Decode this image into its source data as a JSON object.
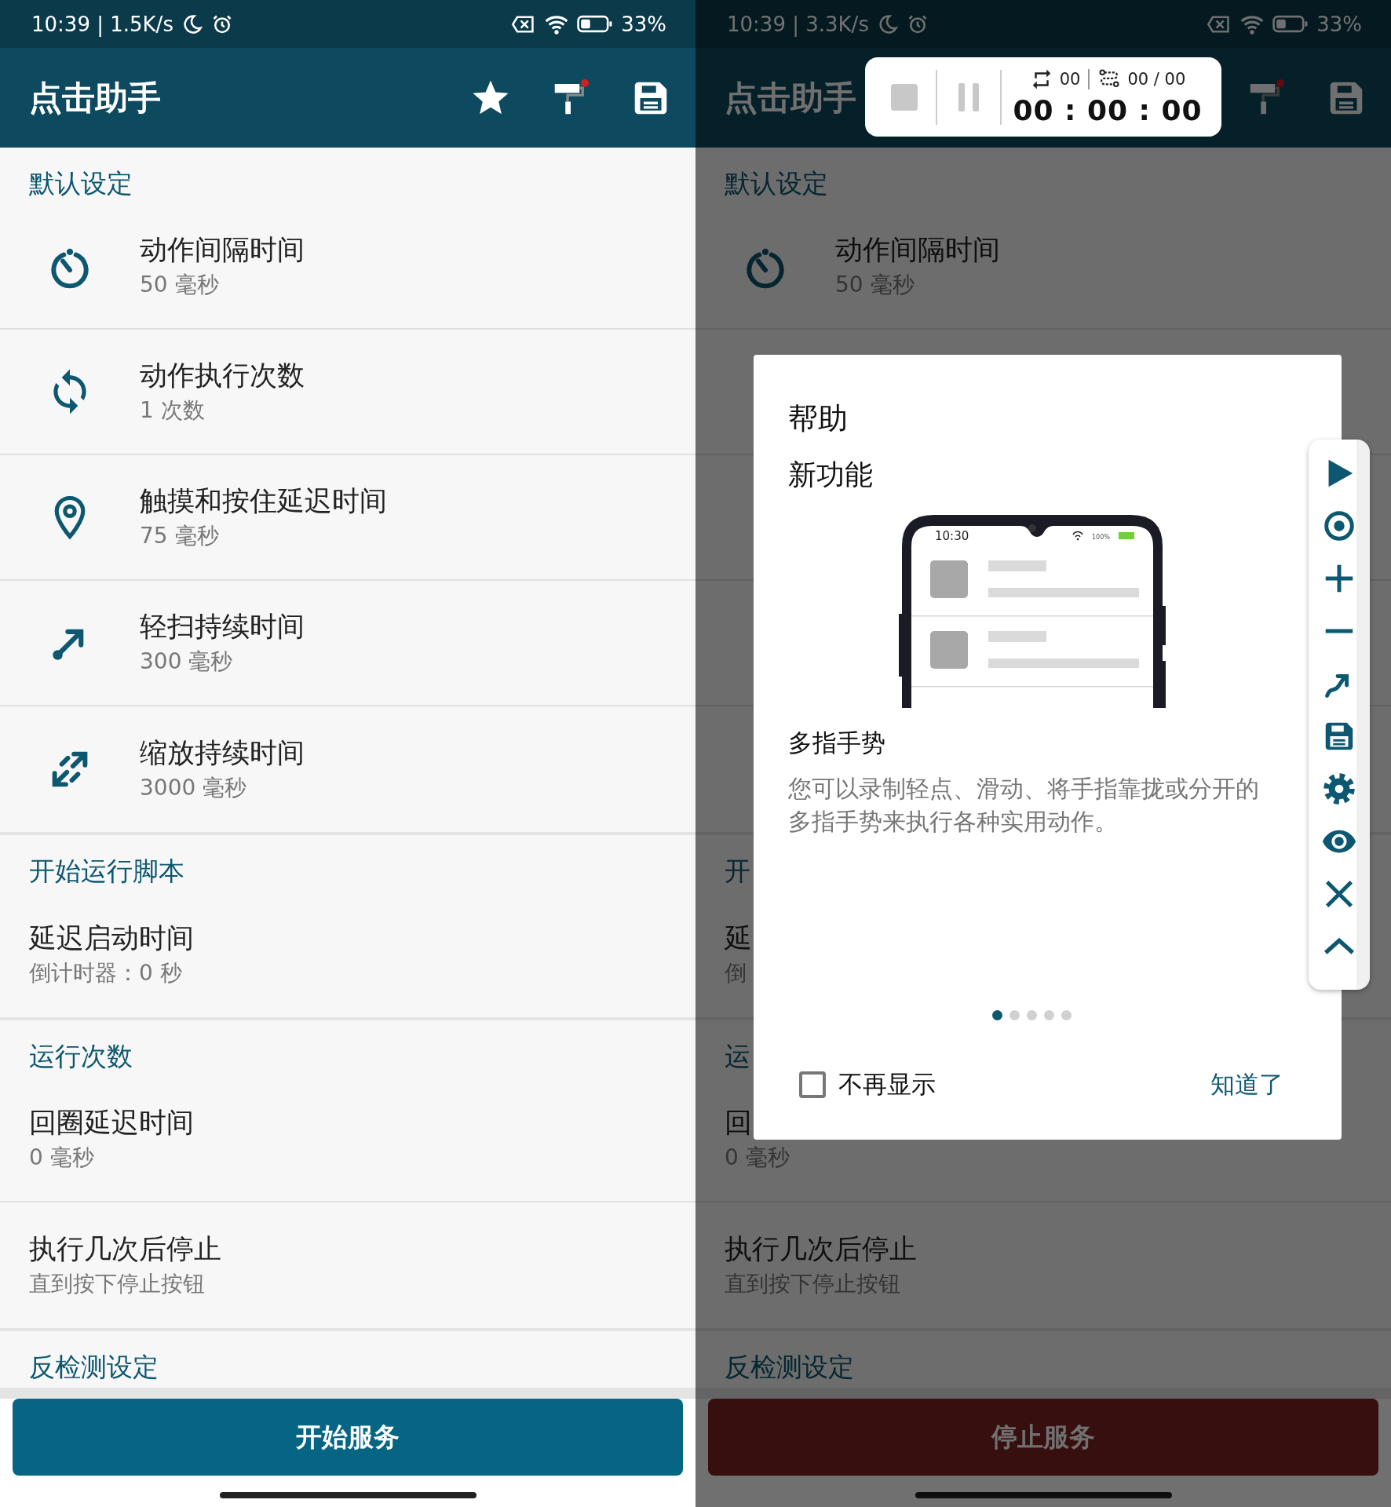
{
  "screens": [
    {
      "status": {
        "time": "10:39 | 1.5K/s",
        "battery": "33%"
      },
      "app_bar": {
        "title": "点击助手",
        "actions": [
          {
            "kind": "star"
          },
          {
            "kind": "roller"
          },
          {
            "kind": "save"
          }
        ]
      },
      "sections": [
        {
          "header": "默认设定",
          "items": [
            {
              "kind": "timer",
              "title": "动作间隔时间",
              "subtitle": "50 毫秒"
            },
            {
              "kind": "sync",
              "title": "动作执行次数",
              "subtitle": "1 次数"
            },
            {
              "kind": "pin",
              "title": "触摸和按住延迟时间",
              "subtitle": "75 毫秒"
            },
            {
              "kind": "swipe",
              "title": "轻扫持续时间",
              "subtitle": "300 毫秒"
            },
            {
              "kind": "pinch",
              "title": "缩放持续时间",
              "subtitle": "3000 毫秒"
            }
          ]
        },
        {
          "header": "开始运行脚本",
          "items": [
            {
              "kind": "plain",
              "title": "延迟启动时间",
              "subtitle": "倒计时器：0 秒"
            }
          ]
        },
        {
          "header": "运行次数",
          "items": [
            {
              "kind": "plain",
              "title": "回圈延迟时间",
              "subtitle": "0 毫秒"
            },
            {
              "kind": "plain",
              "title": "执行几次后停止",
              "subtitle": "直到按下停止按钮"
            }
          ]
        },
        {
          "header": "反检测设定"
        }
      ],
      "button": {
        "kind": "start",
        "label": "开始服务"
      }
    },
    {
      "dimmed": true,
      "status": {
        "time": "10:39 | 3.3K/s",
        "battery": "33%"
      },
      "app_bar": {
        "title": "点击助手",
        "actions": [
          {
            "kind": "roller"
          },
          {
            "kind": "save"
          }
        ]
      },
      "sections": [
        {
          "header": "默认设定",
          "items": [
            {
              "kind": "timer",
              "title": "动作间隔时间",
              "subtitle": "50 毫秒"
            },
            {
              "kind": "covered"
            },
            {
              "kind": "covered"
            },
            {
              "kind": "covered"
            },
            {
              "kind": "covered"
            }
          ]
        },
        {
          "header": "开",
          "items": [
            {
              "kind": "plain",
              "title": "延",
              "subtitle": "倒"
            }
          ]
        },
        {
          "header": "运",
          "items": [
            {
              "kind": "plain",
              "title": "回",
              "subtitle": "0 毫秒"
            },
            {
              "kind": "plain",
              "title": "执行几次后停止",
              "subtitle": "直到按下停止按钮"
            }
          ]
        },
        {
          "header": "反检测设定"
        }
      ],
      "button": {
        "kind": "stop",
        "label": "停止服务"
      },
      "recording_bar": {
        "stop": {
          "disabled": true
        },
        "pause": {
          "disabled": true
        },
        "loop_count": "00",
        "route_count": "00 / 00",
        "timer": "00 : 00 : 00"
      },
      "dialog": {
        "title": "帮助",
        "subtitle": "新功能",
        "illustration": {
          "time": "10:30",
          "battery": "100%"
        },
        "heading": "多指手势",
        "body": "您可以录制轻点、滑动、将手指靠拢或分开的多指手势来执行各种实用动作。",
        "pages": [
          {
            "selected": true
          },
          {
            "selected": false
          },
          {
            "selected": false
          },
          {
            "selected": false
          },
          {
            "selected": false
          }
        ],
        "checkbox": {
          "label": "不再显示",
          "checked": false
        },
        "action": "知道了"
      },
      "floating_toolbar": {
        "tools": [
          {
            "kind": "play"
          },
          {
            "kind": "record"
          },
          {
            "kind": "plus"
          },
          {
            "kind": "minus"
          },
          {
            "kind": "swipe"
          },
          {
            "kind": "save"
          },
          {
            "kind": "settings"
          },
          {
            "kind": "eye"
          },
          {
            "kind": "close"
          },
          {
            "kind": "collapse"
          }
        ]
      }
    }
  ]
}
